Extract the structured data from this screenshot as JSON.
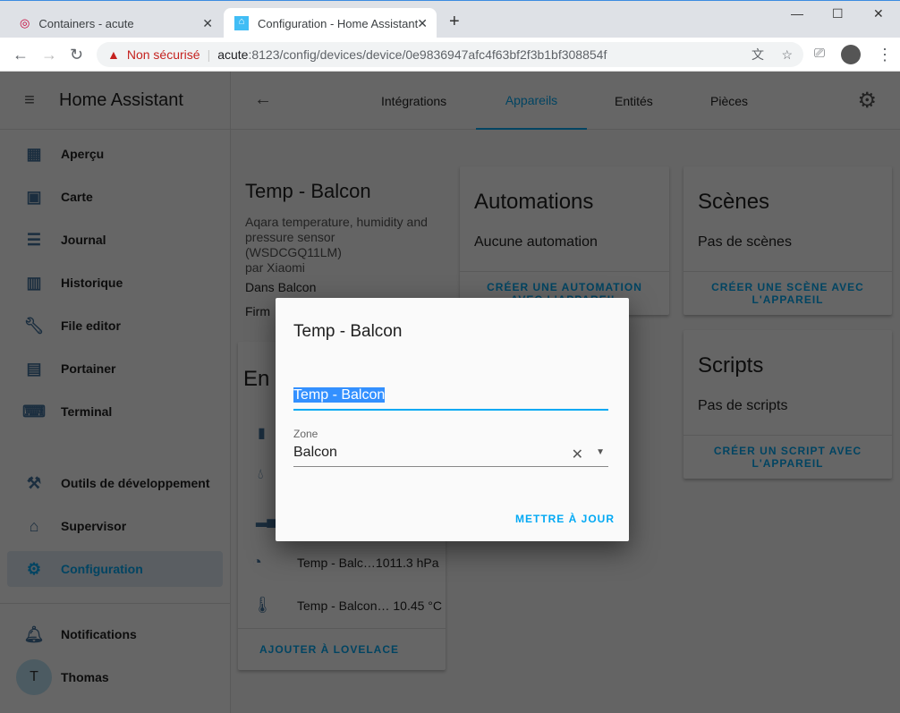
{
  "browser": {
    "tabs": [
      {
        "label": "Containers - acute",
        "icon": "debian-icon"
      },
      {
        "label": "Configuration - Home Assistant",
        "icon": "home-assistant-icon"
      }
    ],
    "security": "Non sécurisé",
    "url_host": "acute",
    "url_rest": ":8123/config/devices/device/0e9836947afc4f63bf2f3b1bf308854f"
  },
  "sidebar": {
    "title": "Home Assistant",
    "items": [
      {
        "label": "Aperçu",
        "icon": "dashboard-icon"
      },
      {
        "label": "Carte",
        "icon": "map-icon"
      },
      {
        "label": "Journal",
        "icon": "list-icon"
      },
      {
        "label": "Historique",
        "icon": "chart-icon"
      },
      {
        "label": "File editor",
        "icon": "wrench-icon"
      },
      {
        "label": "Portainer",
        "icon": "docker-icon"
      },
      {
        "label": "Terminal",
        "icon": "terminal-icon"
      },
      {
        "label": "Outils de développement",
        "icon": "hammer-icon"
      },
      {
        "label": "Supervisor",
        "icon": "supervisor-icon"
      },
      {
        "label": "Configuration",
        "icon": "gear-icon"
      },
      {
        "label": "Notifications",
        "icon": "bell-icon"
      },
      {
        "label": "Thomas",
        "avatar": "T"
      }
    ]
  },
  "header": {
    "tabs": [
      "Intégrations",
      "Appareils",
      "Entités",
      "Pièces"
    ],
    "selected": "Appareils"
  },
  "device": {
    "name": "Temp - Balcon",
    "model": "Aqara temperature, humidity and pressure sensor (WSDCGQ11LM)",
    "manufacturer": "par Xiaomi",
    "area": "Dans Balcon",
    "firmware": "Firm",
    "entities_title": "En",
    "entities": [
      {
        "name": "Temp - Balc…",
        "value": "1011.3 hPa",
        "icon": "gauge-icon"
      },
      {
        "name": "Temp - Balcon…",
        "value": "10.45 °C",
        "icon": "thermometer-icon"
      }
    ],
    "add_lovelace": "AJOUTER À LOVELACE"
  },
  "automations": {
    "title": "Automations",
    "empty": "Aucune automation",
    "action": "CRÉER UNE AUTOMATION AVEC L'APPAREIL"
  },
  "scenes": {
    "title": "Scènes",
    "empty": "Pas de scènes",
    "action": "CRÉER UNE SCÈNE AVEC L'APPAREIL"
  },
  "scripts": {
    "title": "Scripts",
    "empty": "Pas de scripts",
    "action": "CRÉER UN SCRIPT AVEC L'APPAREIL"
  },
  "dialog": {
    "title": "Temp - Balcon",
    "name_value": "Temp - Balcon",
    "zone_label": "Zone",
    "zone_value": "Balcon",
    "update": "METTRE À JOUR"
  },
  "colors": {
    "accent": "#03a9f4",
    "icon": "#44739e"
  }
}
